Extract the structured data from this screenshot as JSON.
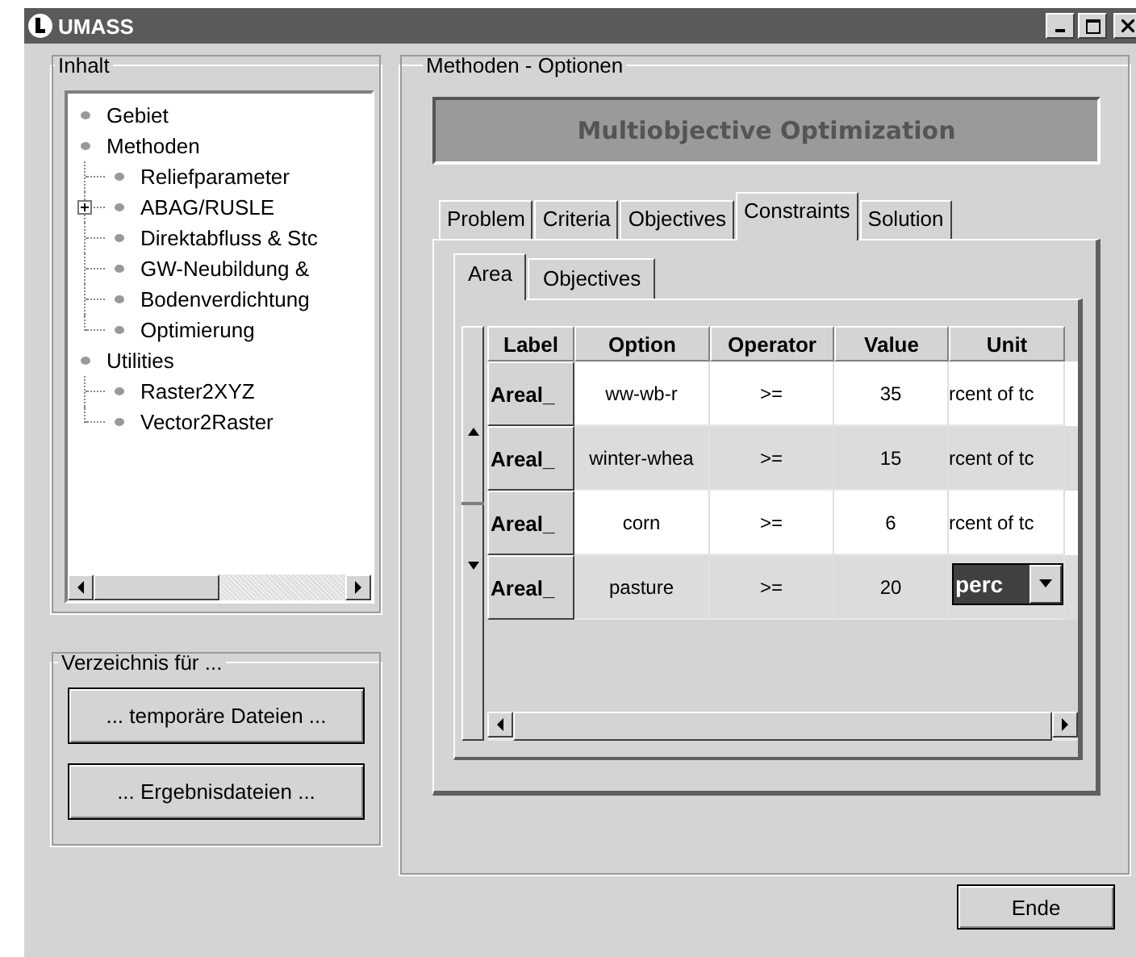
{
  "window": {
    "title": "UMASS"
  },
  "contents": {
    "title": "Inhalt",
    "tree": [
      {
        "label": "Gebiet"
      },
      {
        "label": "Methoden",
        "children": [
          {
            "label": "Reliefparameter"
          },
          {
            "label": "ABAG/RUSLE",
            "expanded": false
          },
          {
            "label": "Direktabfluss & Stc"
          },
          {
            "label": "GW-Neubildung &"
          },
          {
            "label": "Bodenverdichtung"
          },
          {
            "label": "Optimierung"
          }
        ]
      },
      {
        "label": "Utilities",
        "children": [
          {
            "label": "Raster2XYZ"
          },
          {
            "label": "Vector2Raster"
          }
        ]
      }
    ]
  },
  "directory": {
    "title": "Verzeichnis für ...",
    "buttons": [
      "... temporäre Dateien ...",
      "... Ergebnisdateien ..."
    ]
  },
  "options": {
    "title": "Methoden - Optionen",
    "header": "Multiobjective Optimization",
    "tabs": [
      {
        "label": "Problem",
        "selected": false
      },
      {
        "label": "Criteria",
        "selected": false
      },
      {
        "label": "Objectives",
        "selected": false
      },
      {
        "label": "Constraints",
        "selected": true
      },
      {
        "label": "Solution",
        "selected": false
      }
    ],
    "subtabs": [
      {
        "label": "Area",
        "selected": true
      },
      {
        "label": "Objectives",
        "selected": false
      }
    ],
    "columns": [
      "Label",
      "Option",
      "Operator",
      "Value",
      "Unit"
    ],
    "rows": [
      {
        "label": "Areal_",
        "option": "ww-wb-r",
        "operator": ">=",
        "value": "35",
        "unit": "rcent of tc",
        "editing": false
      },
      {
        "label": "Areal_",
        "option": "winter-whea",
        "operator": ">=",
        "value": "15",
        "unit": "rcent of tc",
        "editing": false
      },
      {
        "label": "Areal_",
        "option": "corn",
        "operator": ">=",
        "value": "6",
        "unit": "rcent of tc",
        "editing": false
      },
      {
        "label": "Areal_",
        "option": "pasture",
        "operator": ">=",
        "value": "20",
        "unit": "perc",
        "editing": true
      }
    ]
  },
  "end_button": "Ende"
}
